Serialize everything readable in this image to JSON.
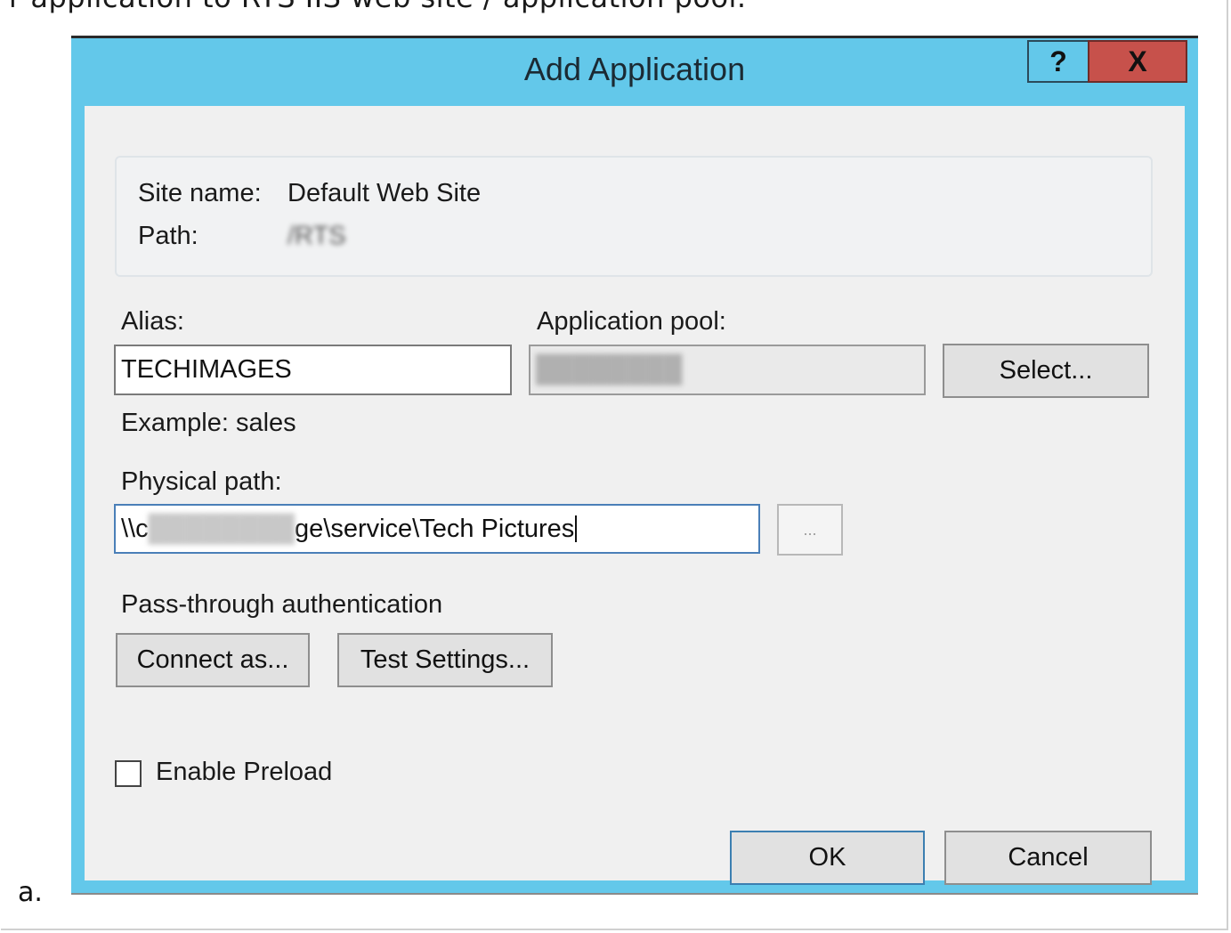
{
  "page": {
    "top_text": "r application to RTS IIS web site / application pool.",
    "step_marker": "a."
  },
  "dialog": {
    "title": "Add Application",
    "help_label": "?",
    "close_label": "X",
    "site_name_label": "Site name:",
    "site_name_value": "Default Web Site",
    "path_label": "Path:",
    "path_value": "/RTS",
    "alias_label": "Alias:",
    "alias_value": "TECHIMAGES",
    "alias_example": "Example: sales",
    "app_pool_label": "Application pool:",
    "app_pool_value": "████████",
    "select_button": "Select...",
    "physical_path_label": "Physical path:",
    "physical_path_prefix": "\\\\c",
    "physical_path_hidden": "████████",
    "physical_path_suffix": "ge\\service\\Tech Pictures",
    "browse_button": "...",
    "passthrough_label": "Pass-through authentication",
    "connect_as_button": "Connect as...",
    "test_settings_button": "Test Settings...",
    "enable_preload_label": "Enable Preload",
    "enable_preload_checked": false,
    "ok_button": "OK",
    "cancel_button": "Cancel"
  },
  "colors": {
    "frame": "#63c8ea",
    "client": "#f0f0f0",
    "close": "#c7514b"
  }
}
